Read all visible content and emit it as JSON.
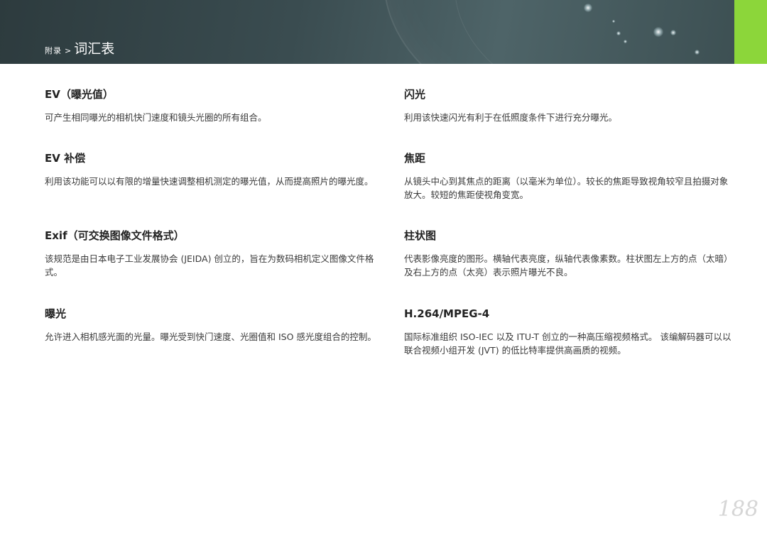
{
  "header": {
    "breadcrumb_parent": "附录",
    "breadcrumb_separator": ">",
    "breadcrumb_current": "词汇表"
  },
  "glossary": {
    "left": [
      {
        "term": "EV（曝光值）",
        "definition": "可产生相同曝光的相机快门速度和镜头光圈的所有组合。"
      },
      {
        "term": "EV 补偿",
        "definition": "利用该功能可以以有限的增量快速调整相机测定的曝光值，从而提高照片的曝光度。"
      },
      {
        "term": "Exif（可交换图像文件格式）",
        "definition": "该规范是由日本电子工业发展协会 (JEIDA) 创立的，旨在为数码相机定义图像文件格式。"
      },
      {
        "term": "曝光",
        "definition": "允许进入相机感光面的光量。曝光受到快门速度、光圈值和 ISO 感光度组合的控制。"
      }
    ],
    "right": [
      {
        "term": "闪光",
        "definition": "利用该快速闪光有利于在低照度条件下进行充分曝光。"
      },
      {
        "term": "焦距",
        "definition": "从镜头中心到其焦点的距离（以毫米为单位）。较长的焦距导致视角较窄且拍摄对象放大。较短的焦距使视角变宽。"
      },
      {
        "term": "柱状图",
        "definition": "代表影像亮度的图形。横轴代表亮度，纵轴代表像素数。柱状图左上方的点（太暗）及右上方的点（太亮）表示照片曝光不良。"
      },
      {
        "term": "H.264/MPEG-4",
        "definition": "国际标准组织 ISO-IEC 以及 ITU-T 创立的一种高压缩视频格式。 该编解码器可以以联合视频小组开发 (JVT) 的低比特率提供高画质的视频。"
      }
    ]
  },
  "page_number": "188",
  "colors": {
    "banner": "#3a4c50",
    "accent_tab": "#8cd63a",
    "page_number": "#d6d6d6"
  }
}
